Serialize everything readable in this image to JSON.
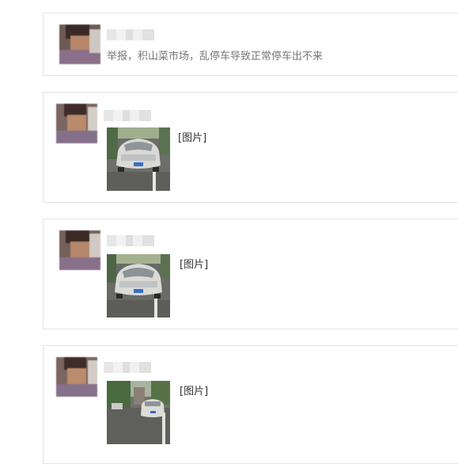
{
  "messages": [
    {
      "type": "text",
      "text": "举报，积山菜市场，乱停车导致正常停车出不来"
    },
    {
      "type": "image",
      "image_label": "[图片]"
    },
    {
      "type": "image",
      "image_label": "[图片]"
    },
    {
      "type": "image",
      "image_label": "[图片]"
    }
  ],
  "colors": {
    "card_border": "#e3e3e3",
    "text_gray": "#777777",
    "label_text": "#333333"
  }
}
